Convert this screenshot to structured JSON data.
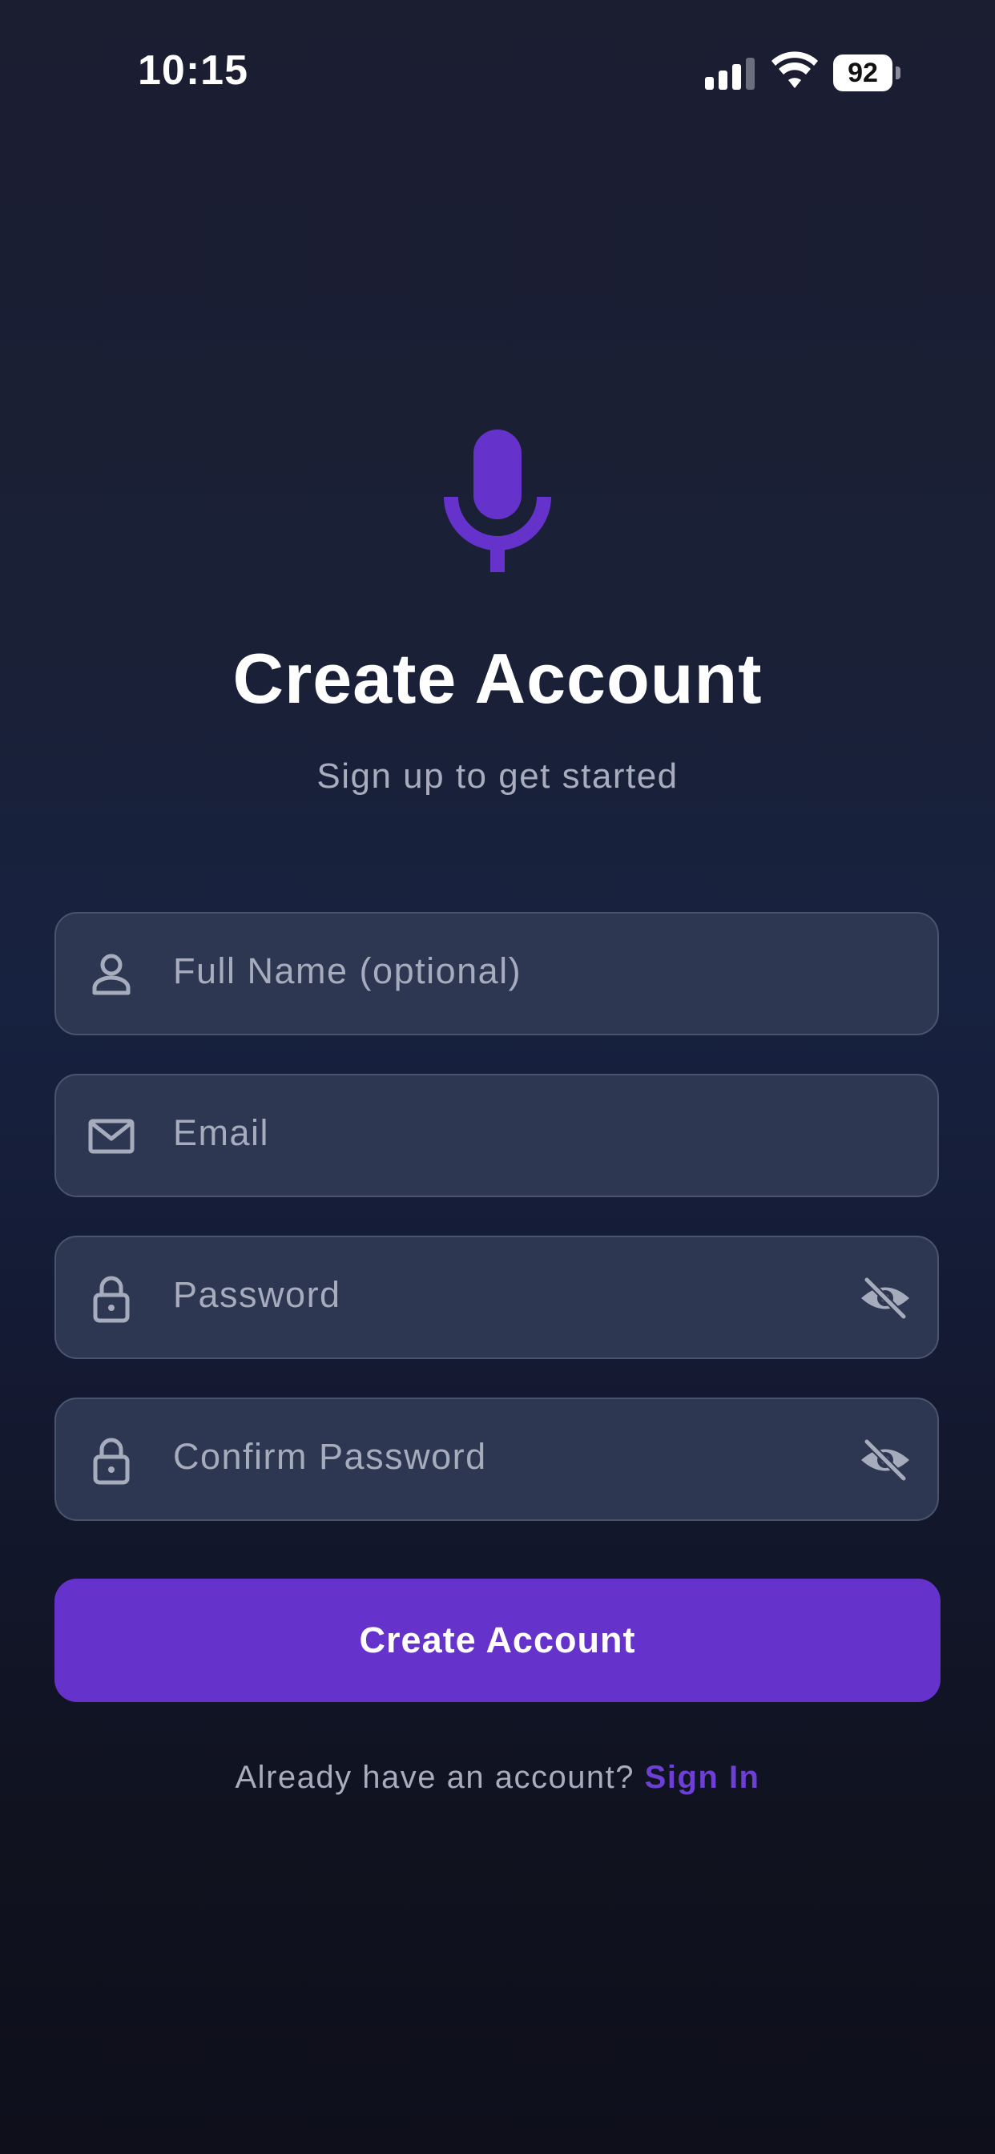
{
  "status_bar": {
    "time": "10:15",
    "battery_level": "92",
    "icons": [
      "signal-icon",
      "wifi-icon",
      "battery-icon"
    ]
  },
  "header": {
    "logo_icon": "microphone-icon",
    "title": "Create Account",
    "subtitle": "Sign up to get started"
  },
  "form": {
    "full_name": {
      "placeholder": "Full Name (optional)",
      "value": "",
      "icon": "person-icon"
    },
    "email": {
      "placeholder": "Email",
      "value": "",
      "icon": "envelope-icon"
    },
    "password": {
      "placeholder": "Password",
      "value": "",
      "icon": "lock-icon",
      "toggle_icon": "eye-off-icon"
    },
    "confirm_password": {
      "placeholder": "Confirm Password",
      "value": "",
      "icon": "lock-icon",
      "toggle_icon": "eye-off-icon"
    },
    "submit_label": "Create Account"
  },
  "footer": {
    "prompt": "Already have an account?",
    "link_label": "Sign In"
  },
  "colors": {
    "accent": "#6532cc",
    "link": "#6d3fd4",
    "field_bg": "#2d3752",
    "field_border": "#4a546d",
    "muted_text": "#a8acbd"
  }
}
